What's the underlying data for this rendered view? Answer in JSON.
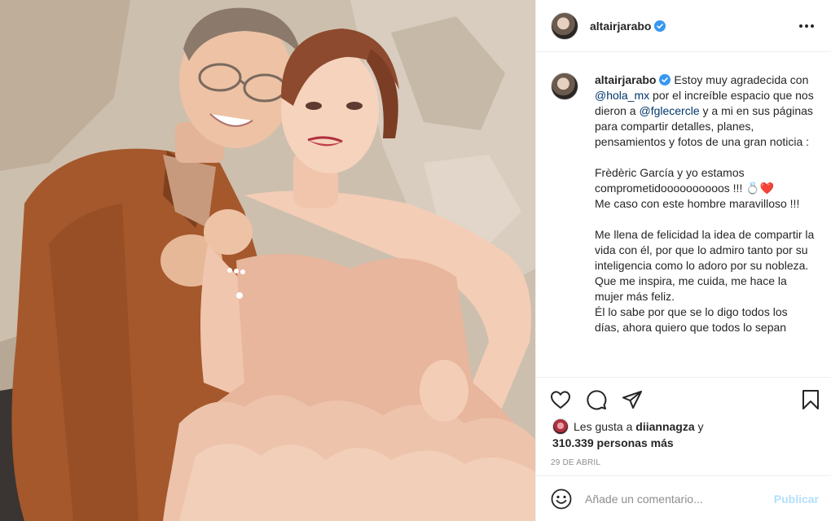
{
  "post": {
    "username": "altairjarabo",
    "verified_icon": "verified-badge-icon",
    "more_icon": "more-options-icon"
  },
  "caption": {
    "username": "altairjarabo",
    "part1": " Estoy muy agradecida con ",
    "mention1": "@hola_mx",
    "part2": " por el increíble espacio que nos dieron a ",
    "mention2": "@fglecercle",
    "part3": " y a mi en sus páginas para compartir detalles, planes, pensamientos y fotos de una gran noticia :\n\nFrèdèric García y yo estamos comprometidoooooooooos !!! 💍❤️\nMe caso con este hombre maravilloso !!!\n\nMe llena de felicidad la idea de compartir la vida con él, por que lo admiro tanto por su inteligencia como lo adoro por su nobleza. Que me inspira, me cuida, me hace la mujer más feliz.\nÉl lo sabe por que se lo digo todos los días, ahora quiero que todos lo sepan"
  },
  "actions": {
    "like_icon": "heart-icon",
    "comment_icon": "comment-icon",
    "share_icon": "share-icon",
    "save_icon": "bookmark-icon"
  },
  "likes": {
    "prefix": "Les gusta a ",
    "user": "diiannagza",
    "middle": " y",
    "count": "310.339 personas más"
  },
  "date": "29 de abril",
  "comment_box": {
    "placeholder": "Añade un comentario...",
    "publish_label": "Publicar",
    "emoji_icon": "emoji-icon"
  },
  "colors": {
    "border": "#efefef",
    "mention": "#00376b",
    "publish_disabled": "#b2dffc",
    "muted": "#8e8e8e",
    "verified": "#3897f0"
  }
}
